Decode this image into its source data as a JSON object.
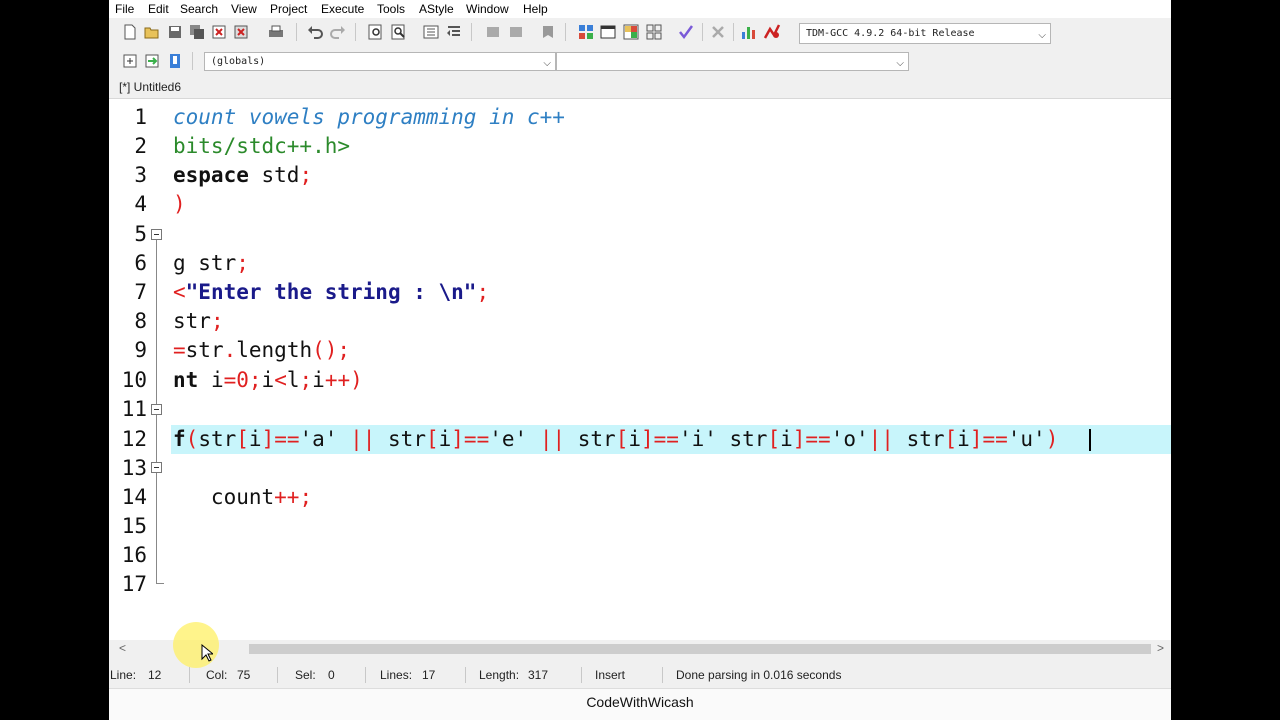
{
  "menu": [
    "File",
    "Edit",
    "Search",
    "View",
    "Project",
    "Execute",
    "Tools",
    "AStyle",
    "Window",
    "Help"
  ],
  "toolbar": {
    "compiler": "TDM-GCC 4.9.2 64-bit Release",
    "scope": "(globals)",
    "member": ""
  },
  "tab": {
    "label": "[*] Untitled6"
  },
  "editor": {
    "line_numbers": [
      "1",
      "2",
      "3",
      "4",
      "5",
      "6",
      "7",
      "8",
      "9",
      "10",
      "11",
      "12",
      "13",
      "14",
      "15",
      "16",
      "17"
    ],
    "current_line": 12
  },
  "status": {
    "line_label": "Line:",
    "line_value": "12",
    "col_label": "Col:",
    "col_value": "75",
    "sel_label": "Sel:",
    "sel_value": "0",
    "lines_label": "Lines:",
    "lines_value": "17",
    "length_label": "Length:",
    "length_value": "317",
    "mode": "Insert",
    "message": "Done parsing in 0.016 seconds"
  },
  "footer": {
    "channel": "CodeWithWicash"
  },
  "colors": {
    "comment": "#2e7fc3",
    "include": "#2b8a2b",
    "symbol": "#e02020",
    "string": "#1a1a8a",
    "current_line": "#c8f5fb"
  },
  "icons": [
    "new-file-icon",
    "open-icon",
    "save-icon",
    "save-all-icon",
    "close-icon",
    "close-all-icon",
    "print-icon",
    "undo-icon",
    "redo-icon",
    "find-icon",
    "replace-icon",
    "indent-icon",
    "unindent-icon",
    "back-icon",
    "forward-icon",
    "bookmark-icon",
    "class-browser-icon",
    "toggle-icon",
    "grid-icon",
    "check-icon",
    "cross-icon",
    "chart-icon",
    "debug-icon"
  ]
}
